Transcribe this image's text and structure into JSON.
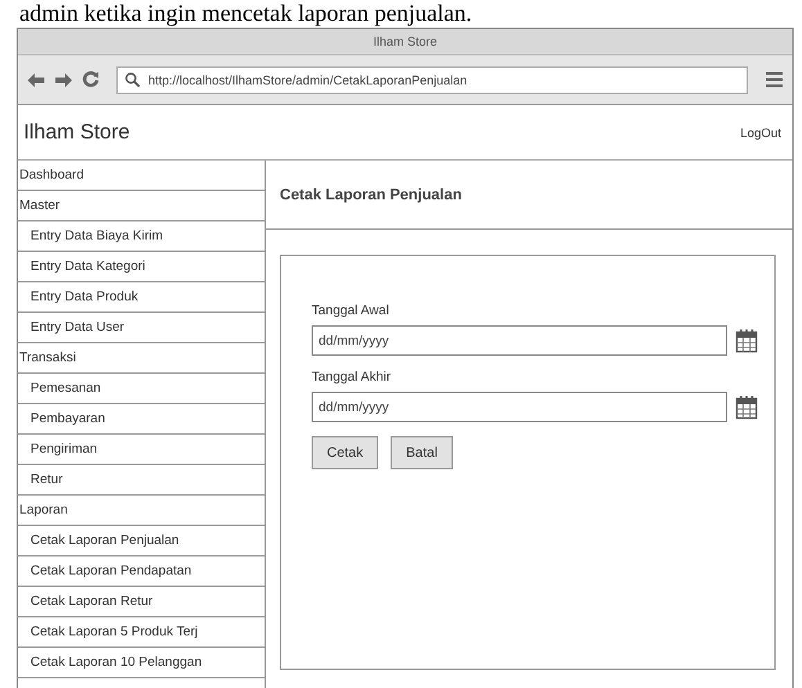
{
  "document_text": "admin ketika ingin mencetak laporan penjualan.",
  "window": {
    "title": "Ilham Store"
  },
  "browser": {
    "url": "http://localhost/IlhamStore/admin/CetakLaporanPenjualan"
  },
  "app_header": {
    "brand": "Ilham Store",
    "logout": "LogOut"
  },
  "sidebar": {
    "items": [
      {
        "label": "Dashboard"
      },
      {
        "label": "Master",
        "children": [
          {
            "label": "Entry Data Biaya Kirim"
          },
          {
            "label": "Entry Data Kategori"
          },
          {
            "label": "Entry Data Produk"
          },
          {
            "label": "Entry Data User"
          }
        ]
      },
      {
        "label": "Transaksi",
        "children": [
          {
            "label": "Pemesanan"
          },
          {
            "label": "Pembayaran"
          },
          {
            "label": "Pengiriman"
          },
          {
            "label": "Retur"
          }
        ]
      },
      {
        "label": "Laporan",
        "children": [
          {
            "label": "Cetak Laporan Penjualan"
          },
          {
            "label": "Cetak Laporan Pendapatan"
          },
          {
            "label": "Cetak Laporan Retur"
          },
          {
            "label": "Cetak Laporan 5 Produk Terj"
          },
          {
            "label": "Cetak Laporan 10 Pelanggan"
          }
        ]
      }
    ]
  },
  "main": {
    "heading": "Cetak Laporan Penjualan",
    "fields": [
      {
        "label": "Tanggal Awal",
        "placeholder": "dd/mm/yyyy"
      },
      {
        "label": "Tanggal Akhir",
        "placeholder": "dd/mm/yyyy"
      }
    ],
    "buttons": [
      "Cetak",
      "Batal"
    ]
  }
}
